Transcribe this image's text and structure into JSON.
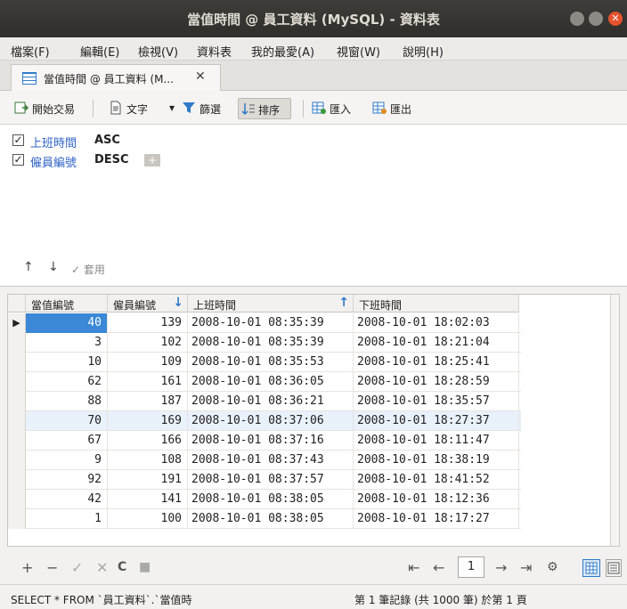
{
  "window": {
    "title": "當值時間 @ 員工資料 (MySQL) - 資料表",
    "close_glyph": "✕"
  },
  "menu": [
    "檔案(F)",
    "編輯(E)",
    "檢視(V)",
    "資料表",
    "我的最愛(A)",
    "視窗(W)",
    "說明(H)"
  ],
  "tab": {
    "label": "當值時間 @ 員工資料 (M...",
    "close": "✕"
  },
  "toolbar": {
    "begin_tx": "開始交易",
    "text": "文字",
    "text_dropdown": "▾",
    "filter": "篩選",
    "sort": "排序",
    "import": "匯入",
    "export": "匯出"
  },
  "sort_rules": [
    {
      "field": "上班時間",
      "direction": "ASC",
      "checked": true,
      "check": "✓"
    },
    {
      "field": "僱員編號",
      "direction": "DESC",
      "checked": true,
      "check": "✓"
    }
  ],
  "sort_controls": {
    "add": "+",
    "up": "↑",
    "down": "↓",
    "apply": "✓ 套用"
  },
  "grid": {
    "columns": [
      {
        "label": "當值編號"
      },
      {
        "label": "僱員編號",
        "sort": "↓"
      },
      {
        "label": "上班時間",
        "sort": "↑"
      },
      {
        "label": "下班時間"
      }
    ],
    "current_row_marker": "▶",
    "rows": [
      [
        "40",
        "139",
        "2008-10-01 08:35:39",
        "2008-10-01 18:02:03"
      ],
      [
        "3",
        "102",
        "2008-10-01 08:35:39",
        "2008-10-01 18:21:04"
      ],
      [
        "10",
        "109",
        "2008-10-01 08:35:53",
        "2008-10-01 18:25:41"
      ],
      [
        "62",
        "161",
        "2008-10-01 08:36:05",
        "2008-10-01 18:28:59"
      ],
      [
        "88",
        "187",
        "2008-10-01 08:36:21",
        "2008-10-01 18:35:57"
      ],
      [
        "70",
        "169",
        "2008-10-01 08:37:06",
        "2008-10-01 18:27:37"
      ],
      [
        "67",
        "166",
        "2008-10-01 08:37:16",
        "2008-10-01 18:11:47"
      ],
      [
        "9",
        "108",
        "2008-10-01 08:37:43",
        "2008-10-01 18:38:19"
      ],
      [
        "92",
        "191",
        "2008-10-01 08:37:57",
        "2008-10-01 18:41:52"
      ],
      [
        "42",
        "141",
        "2008-10-01 08:38:05",
        "2008-10-01 18:12:36"
      ],
      [
        "1",
        "100",
        "2008-10-01 08:38:05",
        "2008-10-01 18:17:27"
      ]
    ]
  },
  "nav": {
    "add": "+",
    "delete": "−",
    "apply": "✓",
    "discard": "✕",
    "refresh": "C",
    "stop": "■",
    "first": "⇤",
    "prev": "←",
    "page": "1",
    "next": "→",
    "last": "⇥",
    "settings": "⚙"
  },
  "status": {
    "sql": "SELECT * FROM `員工資料`.`當值時",
    "records": "第 1 筆記錄 (共 1000 筆) 於第 1 頁"
  },
  "colors": {
    "accent": "#2f7ac8",
    "active_cell": "#3a88d6",
    "selected_row": "#e9f1fb"
  }
}
